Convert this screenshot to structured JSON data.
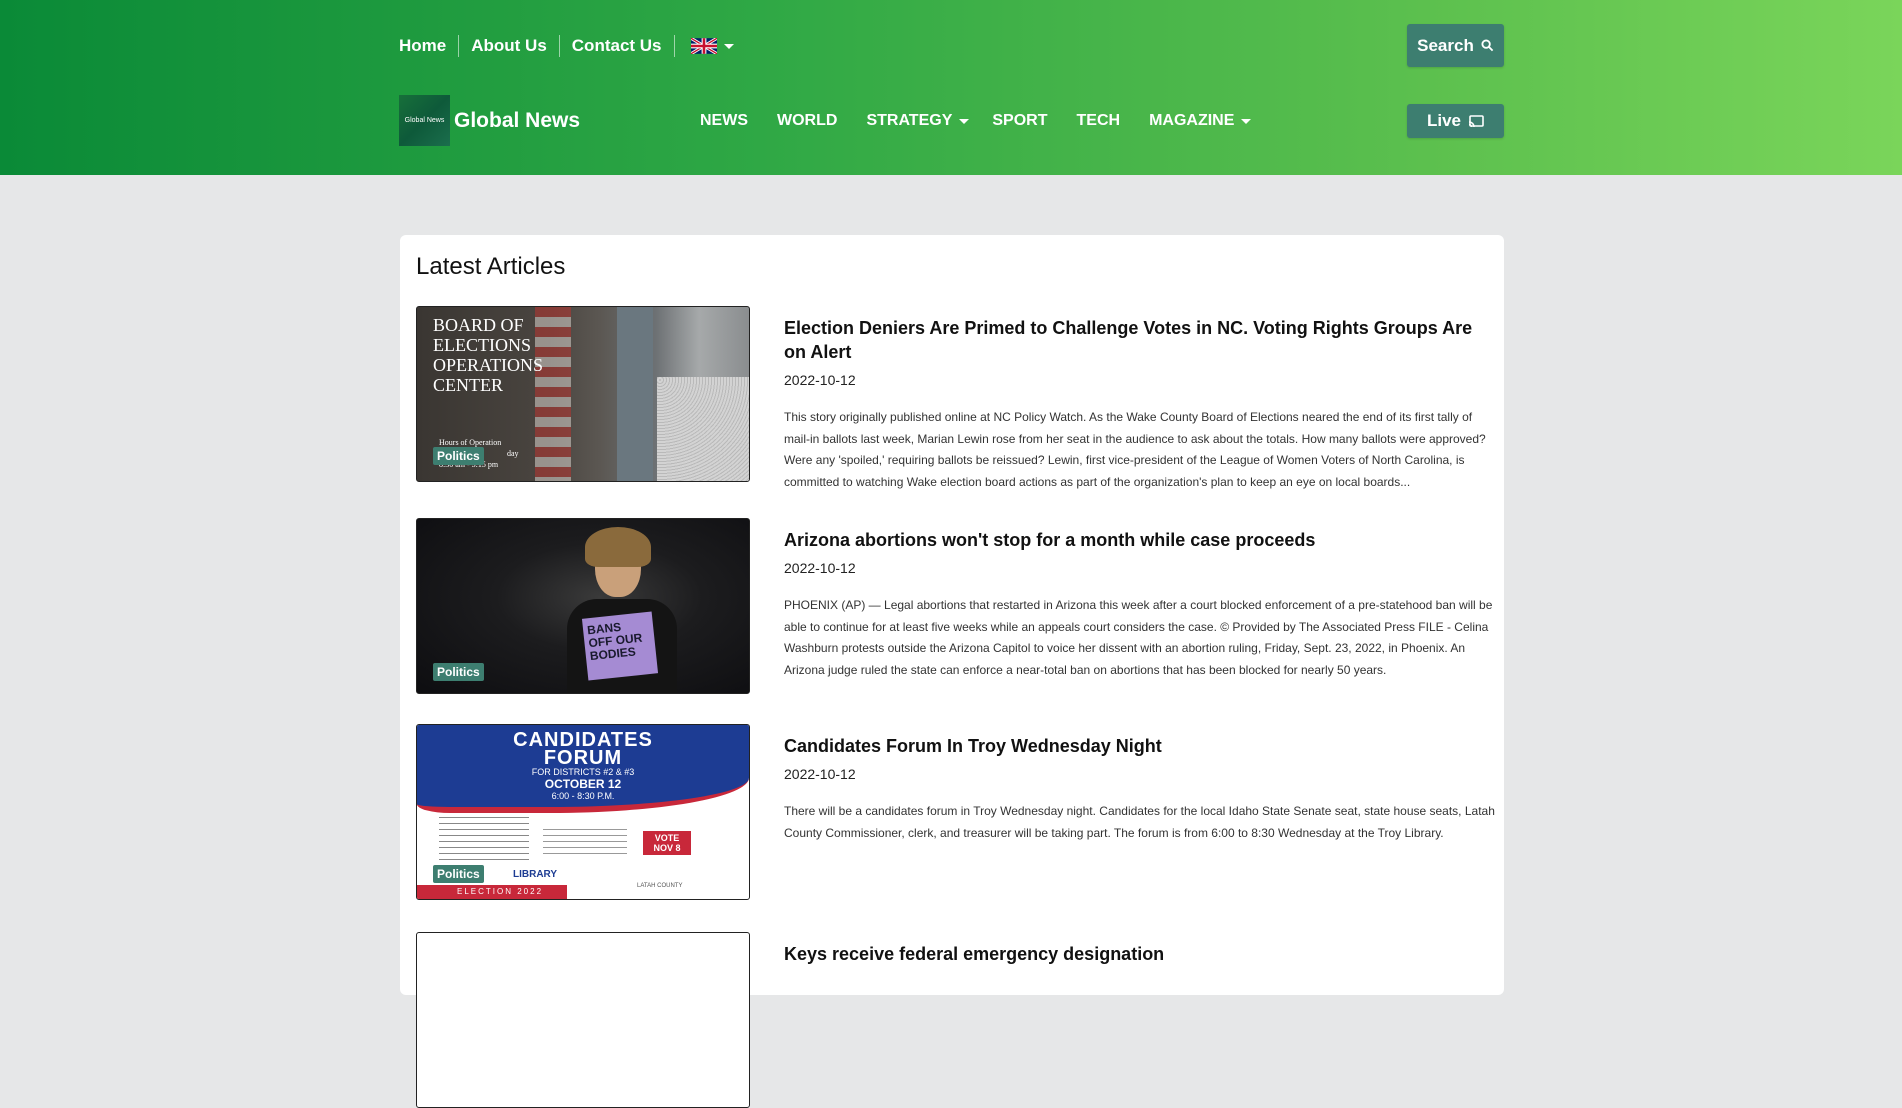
{
  "header": {
    "top_nav": [
      "Home",
      "About Us",
      "Contact Us"
    ],
    "search_label": "Search",
    "live_label": "Live",
    "logo_text": "Global News",
    "brand_name": "Global News"
  },
  "main_nav": [
    {
      "label": "NEWS"
    },
    {
      "label": "WORLD"
    },
    {
      "label": "STRATEGY"
    },
    {
      "label": "SPORT"
    },
    {
      "label": "TECH"
    },
    {
      "label": "MAGAZINE"
    }
  ],
  "section_title": "Latest Articles",
  "articles": [
    {
      "title": "Election Deniers Are Primed to Challenge Votes in NC. Voting Rights Groups Are on Alert",
      "date": "2022-10-12",
      "category": "Politics",
      "excerpt": "This story originally published online at NC Policy Watch.  As the Wake County Board of Elections neared the end of its first tally of mail-in ballots last week, Marian Lewin rose from her seat in the audience to ask about the totals.   How many ballots were approved? Were any 'spoiled,' requiring ballots be reissued?  Lewin, first vice-president of the League of Women Voters of North Carolina, is committed to watching Wake election board actions as part of the organization's plan to keep an eye on local boards...",
      "image_text": [
        "BOARD OF",
        "ELECTIONS",
        "OPERATIONS",
        "CENTER",
        "Hours of Operation",
        "day",
        "8:30 am - 5:15 pm"
      ]
    },
    {
      "title": "Arizona abortions won't stop for a month while case proceeds",
      "date": "2022-10-12",
      "category": "Politics",
      "excerpt": "PHOENIX (AP) — Legal abortions that restarted in Arizona this week after a court blocked enforcement of a pre-statehood ban will be able to continue for at least five weeks while an appeals court considers the case. © Provided by The Associated Press FILE - Celina Washburn protests outside the Arizona Capitol to voice her dissent with an abortion ruling, Friday, Sept. 23, 2022, in Phoenix. An Arizona judge ruled the state can enforce a near-total ban on abortions that has been blocked for nearly 50 years.",
      "image_text": [
        "BANS",
        "OFF OUR",
        "BODIES"
      ]
    },
    {
      "title": "Candidates Forum In Troy Wednesday Night",
      "date": "2022-10-12",
      "category": "Politics",
      "excerpt": "There will be a candidates forum in Troy Wednesday night. Candidates for the local Idaho State Senate seat, state house seats, Latah County Commissioner, clerk, and treasurer will be taking part. The forum is from 6:00 to 8:30 Wednesday at the Troy Library.",
      "image_text": [
        "CANDIDATES",
        "FORUM",
        "FOR DISTRICTS #2 & #3",
        "OCTOBER 12",
        "6:00 - 8:30 P.M.",
        "VOTE",
        "NOV 8",
        "LIBRARY",
        "ELECTION 2022",
        "LATAH COUNTY"
      ]
    },
    {
      "title": "Keys receive federal emergency designation",
      "date": "",
      "category": "",
      "excerpt": "",
      "image_text": []
    }
  ],
  "colors": {
    "header_gradient_start": "#0a8a37",
    "header_gradient_end": "#7ad55a",
    "button_bg": "#3d7e70",
    "badge_bg": "#3d7e70",
    "page_bg": "#e6e7e8"
  },
  "icons": [
    "search-icon",
    "cast-icon",
    "uk-flag-icon",
    "chevron-down-icon"
  ]
}
